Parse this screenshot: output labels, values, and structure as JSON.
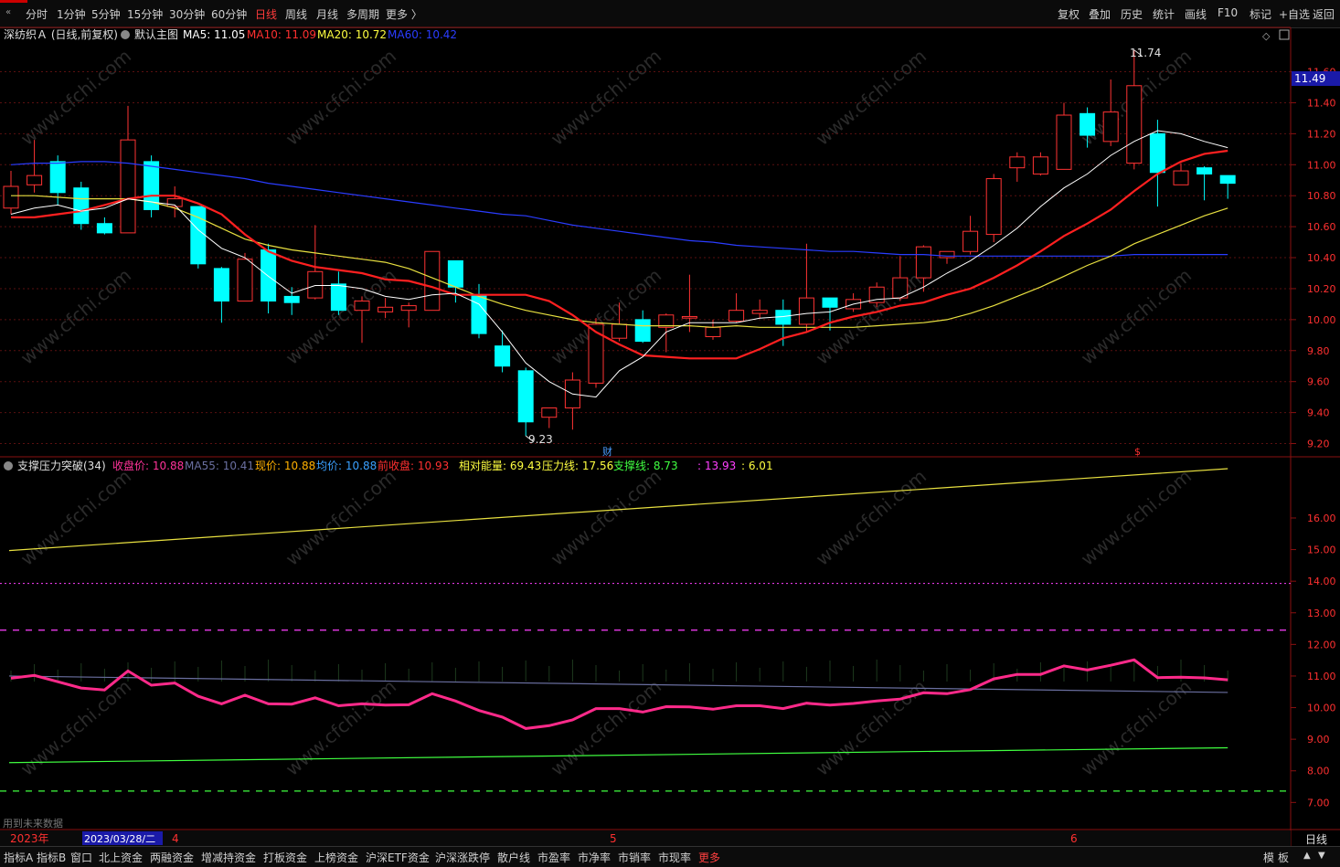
{
  "toolbar": {
    "periods": [
      "分时",
      "1分钟",
      "5分钟",
      "15分钟",
      "30分钟",
      "60分钟",
      "日线",
      "周线",
      "月线",
      "多周期",
      "更多 〉"
    ],
    "active_period": "日线",
    "right_buttons": [
      "复权",
      "叠加",
      "历史",
      "统计",
      "画线",
      "F10",
      "标记",
      "+自选",
      "返回"
    ]
  },
  "main_legend": {
    "stock": "深纺织Ａ (日线,前复权)",
    "template": "默认主图",
    "ma": [
      {
        "label": "MA5: 11.05",
        "color": "#ffffff"
      },
      {
        "label": "MA10: 11.09",
        "color": "#ff3030"
      },
      {
        "label": "MA20: 10.72",
        "color": "#ffff40"
      },
      {
        "label": "MA60: 10.42",
        "color": "#2a3cff"
      }
    ]
  },
  "main_axis": {
    "ticks": [
      "11.60",
      "11.40",
      "11.20",
      "11.00",
      "10.80",
      "10.60",
      "10.40",
      "10.20",
      "10.00",
      "9.80",
      "9.60",
      "9.40",
      "9.20"
    ],
    "ymin": 9.15,
    "ymax": 11.78,
    "current_price": "11.49",
    "high_label": "11.74",
    "low_label": "9.23",
    "event_marker": "财",
    "event_marker2": "$"
  },
  "sub_legend": {
    "name": "支撑压力突破(34)",
    "items": [
      {
        "text": "收盘价: 10.88",
        "color": "#ff3399"
      },
      {
        "text": "MA55: 10.41",
        "color": "#6a6fa0"
      },
      {
        "text": "现价: 10.88",
        "color": "#ffb000"
      },
      {
        "text": "均价: 10.88",
        "color": "#3aa0ff"
      },
      {
        "text": "前收盘: 10.93",
        "color": "#ff3030"
      },
      {
        "text": "相对能量: 69.43",
        "color": "#ffff40"
      },
      {
        "text": "压力线: 17.56",
        "color": "#ffff40"
      },
      {
        "text": "支撑线: 8.73",
        "color": "#40ff40"
      },
      {
        "text": ": 13.93",
        "color": "#ff40ff"
      },
      {
        "text": ": 6.01",
        "color": "#ffff40"
      }
    ]
  },
  "sub_axis": {
    "ticks": [
      "16.00",
      "15.00",
      "14.00",
      "13.00",
      "12.00",
      "11.00",
      "10.00",
      "9.00",
      "8.00",
      "7.00"
    ],
    "ymin": 6.2,
    "ymax": 17.3
  },
  "footnote": "用到未来数据",
  "date_bar": {
    "year": "2023年",
    "cursor_date": "2023/03/28/二",
    "month_marks": [
      "4",
      "5",
      "6"
    ],
    "right_label": "日线"
  },
  "bottom_tabs": [
    "指标A",
    "指标B",
    "窗口",
    "北上资金",
    "两融资金",
    "增减持资金",
    "打板资金",
    "上榜资金",
    "沪深ETF资金",
    "沪深涨跌停",
    "散户线",
    "市盈率",
    "市净率",
    "市销率",
    "市现率",
    "更多"
  ],
  "bottom_right": [
    "模",
    "板"
  ],
  "watermark": "www.cfchi.com",
  "chart_data": {
    "type": "candlestick",
    "title": "深纺织Ａ (日线,前复权)",
    "candles": [
      {
        "o": 10.72,
        "h": 10.96,
        "l": 10.68,
        "c": 10.86
      },
      {
        "o": 10.87,
        "h": 11.16,
        "l": 10.82,
        "c": 10.93
      },
      {
        "o": 11.02,
        "h": 11.06,
        "l": 10.74,
        "c": 10.82
      },
      {
        "o": 10.85,
        "h": 10.89,
        "l": 10.58,
        "c": 10.62
      },
      {
        "o": 10.62,
        "h": 10.66,
        "l": 10.55,
        "c": 10.56
      },
      {
        "o": 10.56,
        "h": 11.38,
        "l": 10.56,
        "c": 11.16
      },
      {
        "o": 11.02,
        "h": 11.06,
        "l": 10.66,
        "c": 10.71
      },
      {
        "o": 10.73,
        "h": 10.86,
        "l": 10.66,
        "c": 10.78
      },
      {
        "o": 10.73,
        "h": 10.73,
        "l": 10.33,
        "c": 10.36
      },
      {
        "o": 10.33,
        "h": 10.34,
        "l": 9.98,
        "c": 10.12
      },
      {
        "o": 10.12,
        "h": 10.43,
        "l": 10.12,
        "c": 10.39
      },
      {
        "o": 10.45,
        "h": 10.49,
        "l": 10.04,
        "c": 10.12
      },
      {
        "o": 10.15,
        "h": 10.21,
        "l": 10.03,
        "c": 10.11
      },
      {
        "o": 10.14,
        "h": 10.61,
        "l": 10.13,
        "c": 10.31
      },
      {
        "o": 10.23,
        "h": 10.31,
        "l": 10.03,
        "c": 10.06
      },
      {
        "o": 10.06,
        "h": 10.15,
        "l": 9.85,
        "c": 10.12
      },
      {
        "o": 10.05,
        "h": 10.14,
        "l": 10.01,
        "c": 10.08
      },
      {
        "o": 10.06,
        "h": 10.11,
        "l": 9.95,
        "c": 10.09
      },
      {
        "o": 10.06,
        "h": 10.43,
        "l": 10.06,
        "c": 10.44
      },
      {
        "o": 10.38,
        "h": 10.38,
        "l": 10.11,
        "c": 10.21
      },
      {
        "o": 10.16,
        "h": 10.23,
        "l": 9.88,
        "c": 9.91
      },
      {
        "o": 9.83,
        "h": 9.93,
        "l": 9.66,
        "c": 9.7
      },
      {
        "o": 9.67,
        "h": 9.69,
        "l": 9.25,
        "c": 9.34
      },
      {
        "o": 9.37,
        "h": 9.42,
        "l": 9.3,
        "c": 9.43
      },
      {
        "o": 9.43,
        "h": 9.66,
        "l": 9.29,
        "c": 9.61
      },
      {
        "o": 9.59,
        "h": 10.01,
        "l": 9.56,
        "c": 9.97
      },
      {
        "o": 9.88,
        "h": 10.11,
        "l": 9.86,
        "c": 9.97
      },
      {
        "o": 10.0,
        "h": 10.06,
        "l": 9.85,
        "c": 9.86
      },
      {
        "o": 9.95,
        "h": 10.04,
        "l": 9.79,
        "c": 10.03
      },
      {
        "o": 10.01,
        "h": 10.29,
        "l": 9.92,
        "c": 10.02
      },
      {
        "o": 9.89,
        "h": 10.0,
        "l": 9.87,
        "c": 9.95
      },
      {
        "o": 9.99,
        "h": 10.17,
        "l": 9.98,
        "c": 10.06
      },
      {
        "o": 10.04,
        "h": 10.13,
        "l": 10.01,
        "c": 10.06
      },
      {
        "o": 10.06,
        "h": 10.13,
        "l": 9.83,
        "c": 9.97
      },
      {
        "o": 9.97,
        "h": 10.49,
        "l": 9.92,
        "c": 10.14
      },
      {
        "o": 10.14,
        "h": 10.14,
        "l": 9.93,
        "c": 10.08
      },
      {
        "o": 10.07,
        "h": 10.17,
        "l": 10.05,
        "c": 10.13
      },
      {
        "o": 10.11,
        "h": 10.24,
        "l": 10.08,
        "c": 10.21
      },
      {
        "o": 10.14,
        "h": 10.41,
        "l": 10.12,
        "c": 10.27
      },
      {
        "o": 10.27,
        "h": 10.48,
        "l": 10.18,
        "c": 10.47
      },
      {
        "o": 10.4,
        "h": 10.44,
        "l": 10.36,
        "c": 10.44
      },
      {
        "o": 10.44,
        "h": 10.67,
        "l": 10.42,
        "c": 10.57
      },
      {
        "o": 10.55,
        "h": 10.94,
        "l": 10.5,
        "c": 10.91
      },
      {
        "o": 10.98,
        "h": 11.08,
        "l": 10.89,
        "c": 11.05
      },
      {
        "o": 10.94,
        "h": 11.08,
        "l": 10.93,
        "c": 11.05
      },
      {
        "o": 10.97,
        "h": 11.4,
        "l": 10.97,
        "c": 11.32
      },
      {
        "o": 11.33,
        "h": 11.37,
        "l": 11.11,
        "c": 11.19
      },
      {
        "o": 11.15,
        "h": 11.55,
        "l": 11.12,
        "c": 11.34
      },
      {
        "o": 11.01,
        "h": 11.74,
        "l": 10.97,
        "c": 11.51
      },
      {
        "o": 11.2,
        "h": 11.29,
        "l": 10.73,
        "c": 10.95
      },
      {
        "o": 10.87,
        "h": 11.01,
        "l": 10.87,
        "c": 10.96
      },
      {
        "o": 10.98,
        "h": 10.99,
        "l": 10.77,
        "c": 10.94
      },
      {
        "o": 10.93,
        "h": 10.93,
        "l": 10.78,
        "c": 10.88
      }
    ],
    "ma5": [
      10.68,
      10.72,
      10.74,
      10.7,
      10.72,
      10.78,
      10.76,
      10.74,
      10.58,
      10.46,
      10.4,
      10.28,
      10.17,
      10.22,
      10.22,
      10.2,
      10.15,
      10.13,
      10.16,
      10.17,
      10.1,
      9.92,
      9.72,
      9.6,
      9.52,
      9.5,
      9.67,
      9.76,
      9.92,
      9.98,
      9.98,
      9.98,
      10.01,
      10.02,
      10.04,
      10.05,
      10.1,
      10.13,
      10.14,
      10.21,
      10.3,
      10.38,
      10.48,
      10.59,
      10.73,
      10.85,
      10.94,
      11.06,
      11.15,
      11.22,
      11.2,
      11.15,
      11.11
    ],
    "ma10": [
      10.66,
      10.66,
      10.68,
      10.7,
      10.74,
      10.78,
      10.8,
      10.8,
      10.75,
      10.68,
      10.55,
      10.44,
      10.38,
      10.34,
      10.32,
      10.3,
      10.26,
      10.25,
      10.21,
      10.16,
      10.16,
      10.16,
      10.16,
      10.12,
      10.03,
      9.92,
      9.84,
      9.77,
      9.76,
      9.75,
      9.75,
      9.75,
      9.81,
      9.88,
      9.92,
      9.98,
      10.02,
      10.05,
      10.09,
      10.11,
      10.16,
      10.2,
      10.27,
      10.35,
      10.44,
      10.54,
      10.62,
      10.71,
      10.83,
      10.94,
      11.02,
      11.07,
      11.09
    ],
    "ma20": [
      10.8,
      10.8,
      10.79,
      10.78,
      10.78,
      10.78,
      10.76,
      10.72,
      10.66,
      10.59,
      10.52,
      10.48,
      10.45,
      10.43,
      10.41,
      10.39,
      10.37,
      10.33,
      10.27,
      10.21,
      10.15,
      10.1,
      10.06,
      10.03,
      10.0,
      9.98,
      9.97,
      9.96,
      9.96,
      9.96,
      9.95,
      9.96,
      9.95,
      9.95,
      9.95,
      9.95,
      9.95,
      9.96,
      9.97,
      9.98,
      10.0,
      10.04,
      10.09,
      10.15,
      10.21,
      10.28,
      10.35,
      10.41,
      10.49,
      10.55,
      10.61,
      10.67,
      10.72
    ],
    "ma60": [
      11.0,
      11.01,
      11.01,
      11.02,
      11.02,
      11.01,
      10.99,
      10.97,
      10.95,
      10.93,
      10.91,
      10.88,
      10.86,
      10.84,
      10.82,
      10.8,
      10.78,
      10.76,
      10.74,
      10.72,
      10.7,
      10.68,
      10.67,
      10.64,
      10.61,
      10.59,
      10.57,
      10.55,
      10.53,
      10.51,
      10.5,
      10.48,
      10.47,
      10.46,
      10.45,
      10.44,
      10.44,
      10.43,
      10.42,
      10.42,
      10.41,
      10.41,
      10.41,
      10.41,
      10.41,
      10.41,
      10.41,
      10.41,
      10.42,
      10.42,
      10.42,
      10.42,
      10.42
    ],
    "sub_close": [
      10.93,
      11.02,
      10.82,
      10.62,
      10.56,
      11.16,
      10.71,
      10.78,
      10.36,
      10.12,
      10.39,
      10.12,
      10.11,
      10.31,
      10.06,
      10.12,
      10.08,
      10.09,
      10.44,
      10.21,
      9.91,
      9.7,
      9.34,
      9.43,
      9.61,
      9.97,
      9.97,
      9.86,
      10.03,
      10.02,
      9.95,
      10.06,
      10.06,
      9.97,
      10.14,
      10.08,
      10.13,
      10.21,
      10.27,
      10.47,
      10.44,
      10.57,
      10.91,
      11.05,
      11.05,
      11.32,
      11.19,
      11.34,
      11.51,
      10.95,
      10.96,
      10.94,
      10.88
    ],
    "sub_ma55": [
      11.0,
      10.48
    ],
    "pressure_line": [
      14.97,
      17.56
    ],
    "support_line": [
      8.26,
      8.73
    ],
    "pink_level": 13.93,
    "magenta_level": 12.45,
    "green_level": 7.36,
    "yellow_dotted_level": 6.01
  }
}
